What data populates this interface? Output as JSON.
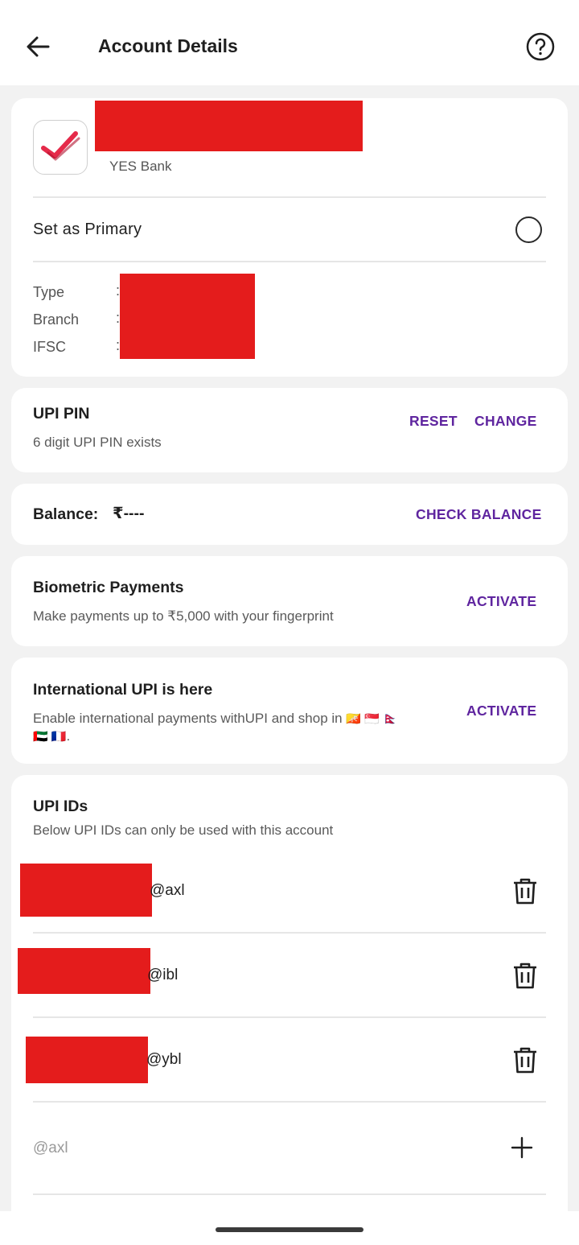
{
  "header": {
    "title": "Account Details",
    "back_icon": "arrow-left-icon",
    "help_icon": "help-circle-icon"
  },
  "account": {
    "bank_name": "YES Bank",
    "primary_label": "Set as Primary",
    "details": [
      {
        "label": "Type",
        "sep": ":"
      },
      {
        "label": "Branch",
        "sep": ":"
      },
      {
        "label": "IFSC",
        "sep": ":"
      }
    ]
  },
  "upi_pin": {
    "title": "UPI PIN",
    "subtitle": "6 digit UPI PIN exists",
    "reset_label": "RESET",
    "change_label": "CHANGE"
  },
  "balance": {
    "label": "Balance:",
    "value": "₹----",
    "check_label": "CHECK BALANCE"
  },
  "biometric": {
    "title": "Biometric Payments",
    "subtitle": "Make payments up to ₹5,000 with your fingerprint",
    "action_label": "ACTIVATE"
  },
  "international": {
    "title": "International UPI is here",
    "subtitle_line1": "Enable international payments withUPI and shop in",
    "flags_line1": "🇧🇹 🇸🇬 🇳🇵",
    "flags_line2": "🇦🇪 🇫🇷",
    "line2_end": ".",
    "action_label": "ACTIVATE"
  },
  "upi_ids": {
    "title": "UPI IDs",
    "subtitle": "Below UPI IDs can only be used with this account",
    "items": [
      {
        "suffix": "@axl"
      },
      {
        "suffix": "@ibl"
      },
      {
        "suffix": "@ybl"
      }
    ],
    "new_placeholder": "@axl"
  },
  "colors": {
    "accent": "#5f259f",
    "redaction": "#e41c1c"
  }
}
